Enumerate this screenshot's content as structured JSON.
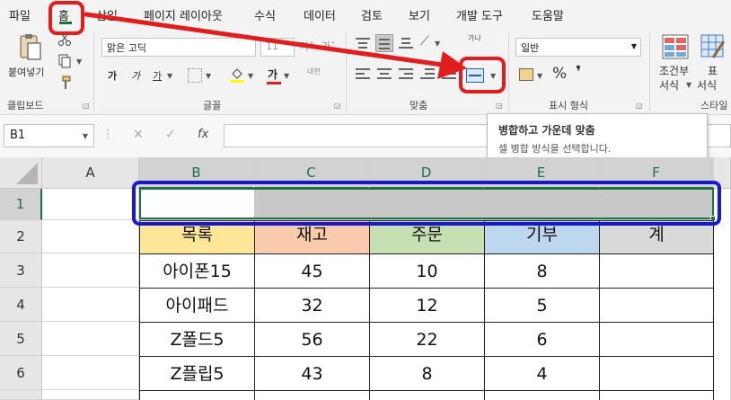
{
  "menu": {
    "items": [
      "파일",
      "홈",
      "삽입",
      "페이지 레이아웃",
      "수식",
      "데이터",
      "검토",
      "보기",
      "개발 도구",
      "도움말"
    ]
  },
  "ribbon": {
    "paste_label": "붙여넣기",
    "font_name": "맑은 고딕",
    "font_size": "11",
    "bold": "가",
    "italic": "가",
    "underline": "가",
    "font_color_glyph": "가",
    "phonetic_label": "내천",
    "orientation_label": "가나",
    "number_format": "일반",
    "percent": "%",
    "comma": "❜",
    "cond_format_label_1": "조건부",
    "cond_format_label_2": "서식",
    "table_label_1": "표",
    "table_label_2": "서식",
    "groups": {
      "clipboard": "클립보드",
      "font": "글꼴",
      "alignment": "맞춤",
      "number": "표시 형식",
      "styles": "스타일"
    }
  },
  "tooltip": {
    "title": "병합하고 가운데 맞춤",
    "desc": "셀 병합 방식을 선택합니다."
  },
  "formula_bar": {
    "name_box": "B1",
    "cancel": "✕",
    "enter": "✓",
    "fx": "fx"
  },
  "grid": {
    "columns": [
      "A",
      "B",
      "C",
      "D",
      "E",
      "F"
    ],
    "rows": [
      "1",
      "2",
      "3",
      "4",
      "5",
      "6"
    ],
    "headers": [
      "목록",
      "재고",
      "주문",
      "기부",
      "계"
    ],
    "data": [
      [
        "아이폰15",
        "45",
        "10",
        "8",
        ""
      ],
      [
        "아이패드",
        "32",
        "12",
        "5",
        ""
      ],
      [
        "Z폴드5",
        "56",
        "22",
        "6",
        ""
      ],
      [
        "Z플립5",
        "43",
        "8",
        "4",
        ""
      ]
    ]
  },
  "colors": {
    "accent_green": "#1e7145",
    "annotation_red": "#e01e1e",
    "annotation_blue": "#1717d6",
    "header_yellow": "#ffe699",
    "header_orange": "#f8cbad",
    "header_green": "#c6e0b4",
    "header_blue": "#bdd7ee",
    "header_gray": "#d9d9d9",
    "selection_gray": "#c8c8c8"
  }
}
